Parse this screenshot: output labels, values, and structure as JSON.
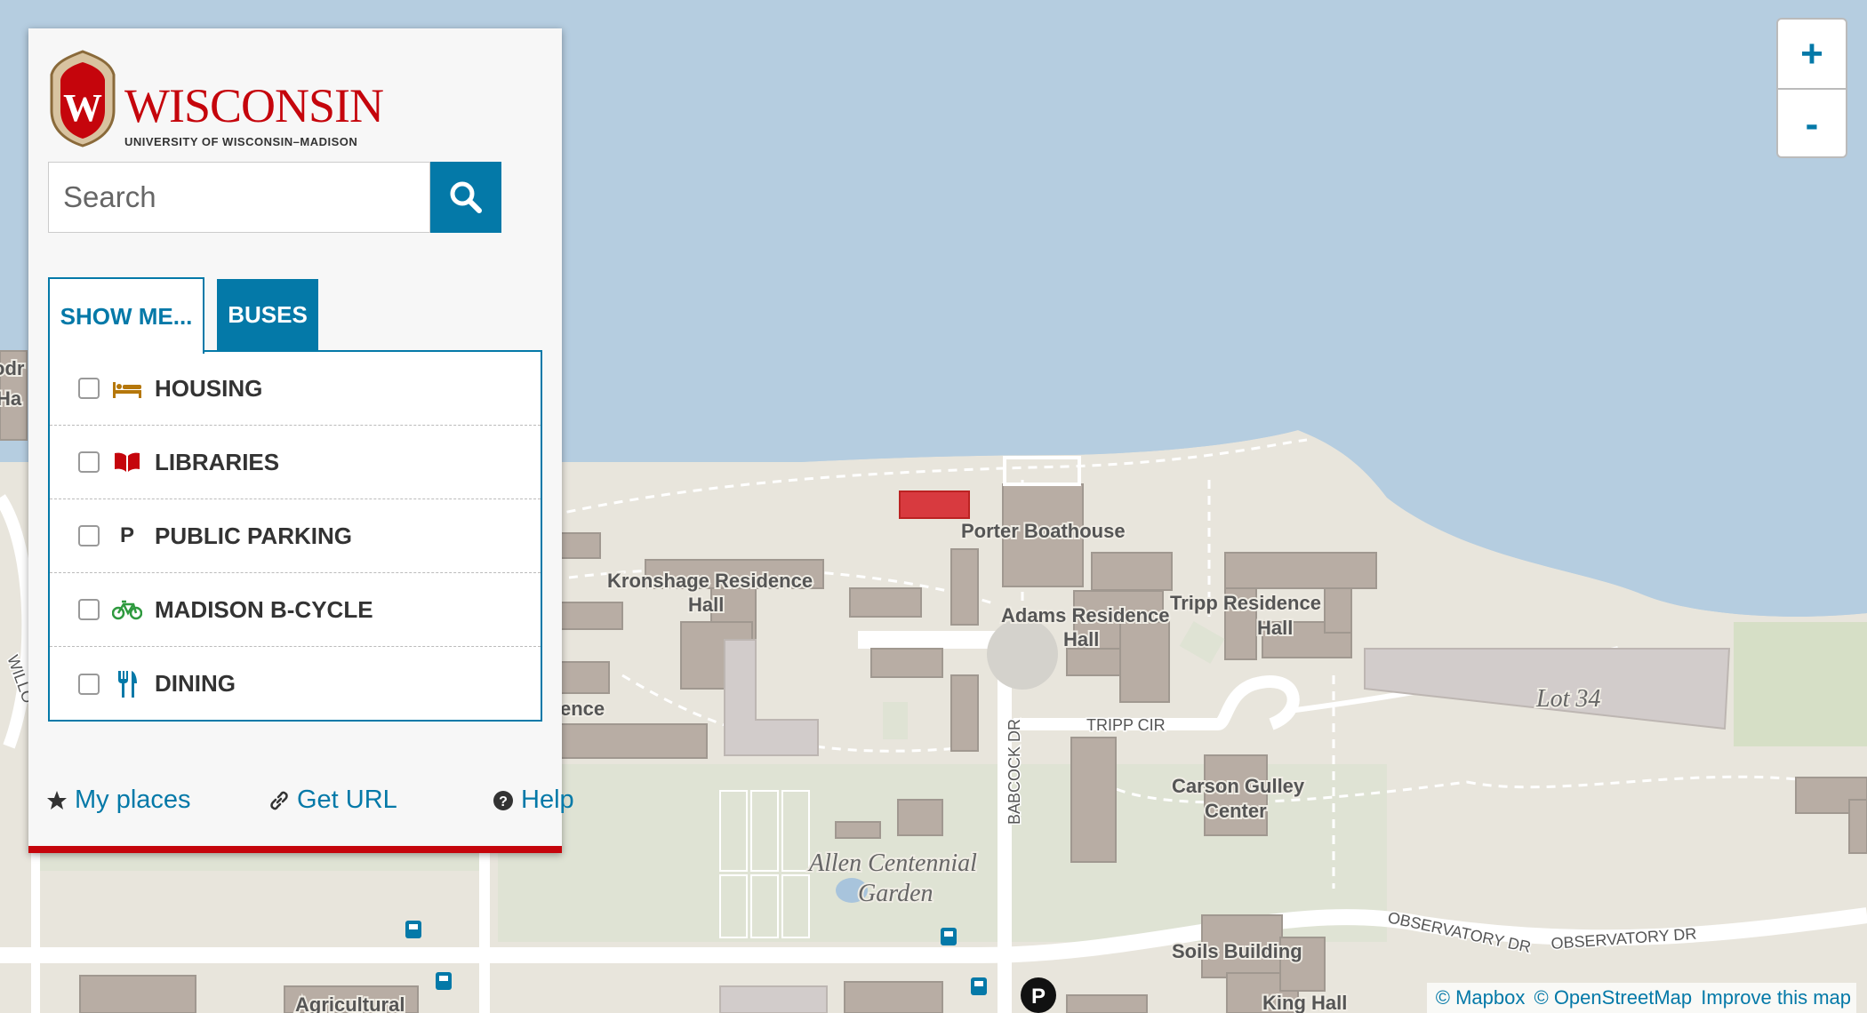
{
  "brand": {
    "wordmark": "WISCONSIN",
    "subtitle": "UNIVERSITY OF WISCONSIN–MADISON"
  },
  "search": {
    "placeholder": "Search"
  },
  "tabs": [
    {
      "label": "SHOW ME..."
    },
    {
      "label": "BUSES"
    }
  ],
  "layers": [
    {
      "label": "HOUSING",
      "icon": "bed-icon",
      "color": "#b5770b"
    },
    {
      "label": "LIBRARIES",
      "icon": "book-icon",
      "color": "#c5050c"
    },
    {
      "label": "PUBLIC PARKING",
      "icon": "parking-letter-icon",
      "glyph": "P",
      "color": "#333333"
    },
    {
      "label": "MADISON B-CYCLE",
      "icon": "bicycle-icon",
      "color": "#2f9a3f"
    },
    {
      "label": "DINING",
      "icon": "fork-knife-icon",
      "color": "#0479a8"
    }
  ],
  "footer": {
    "my_places": "My places",
    "get_url": "Get URL",
    "help": "Help"
  },
  "zoom": {
    "in": "+",
    "out": "-"
  },
  "attribution": {
    "mapbox": "© Mapbox",
    "osm": "© OpenStreetMap",
    "improve": "Improve this map"
  },
  "map_labels": {
    "porter": "Porter Boathouse",
    "kronshage_1": "Kronshage Residence",
    "kronshage_2": "Hall",
    "adams_1": "Adams Residence",
    "adams_2": "Hall",
    "tripp_1": "Tripp Residence",
    "tripp_2": "Hall",
    "carson_1": "Carson Gulley",
    "carson_2": "Center",
    "garden_1": "Allen Centennial",
    "garden_2": "Garden",
    "soils": "Soils Building",
    "king": "King Hall",
    "agricultural": "Agricultural",
    "lot34": "Lot 34",
    "tripp_cir": "TRIPP CIR",
    "babcock": "BABCOCK DR",
    "observatory_1": "OBSERVATORY DR",
    "observatory_2": "OBSERVATORY DR",
    "ence": "ence",
    "willow": "WILLO",
    "left_1": "odr",
    "left_2": "Ha",
    "parking_marker": "P"
  },
  "colors": {
    "water": "#b5cde0",
    "land": "#e8e5dc",
    "building": "#b8ada4",
    "highlight": "#d83a3f",
    "accent": "#0479a8",
    "brand_red": "#c5050c"
  }
}
